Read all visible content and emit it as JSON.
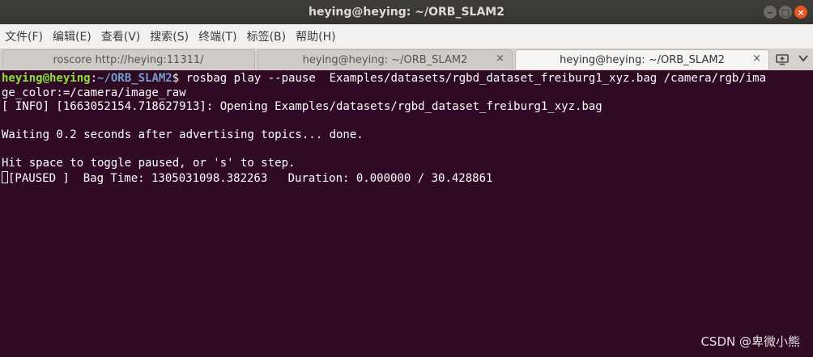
{
  "window": {
    "title": "heying@heying: ~/ORB_SLAM2",
    "controls": {
      "minimize": "‒",
      "maximize": "□",
      "close": "×"
    }
  },
  "menubar": {
    "items": [
      "文件(F)",
      "编辑(E)",
      "查看(V)",
      "搜索(S)",
      "终端(T)",
      "标签(B)",
      "帮助(H)"
    ]
  },
  "tabs": [
    {
      "label": "roscore http://heying:11311/",
      "active": false
    },
    {
      "label": "heying@heying: ~/ORB_SLAM2",
      "active": false,
      "close": "×"
    },
    {
      "label": "heying@heying: ~/ORB_SLAM2",
      "active": true,
      "close": "×"
    }
  ],
  "tabbar_icons": [
    "new-tab-icon",
    "tab-menu-chevron-icon"
  ],
  "terminal": {
    "prompt_user": "heying@heying",
    "prompt_sep": ":",
    "prompt_path": "~/ORB_SLAM2",
    "prompt_symbol": "$",
    "command": " rosbag play --pause  Examples/datasets/rgbd_dataset_freiburg1_xyz.bag /camera/rgb/ima",
    "command_wrap": "ge_color:=/camera/image_raw",
    "line_info": "[ INFO] [1663052154.718627913]: Opening Examples/datasets/rgbd_dataset_freiburg1_xyz.bag",
    "line_waiting": "Waiting 0.2 seconds after advertising topics... done.",
    "line_hint": "Hit space to toggle paused, or 's' to step.",
    "line_status": "[PAUSED ]  Bag Time: 1305031098.382263   Duration: 0.000000 / 30.428861"
  },
  "watermark": "CSDN @卑微小熊",
  "colors": {
    "terminal_bg": "#300a24",
    "prompt_user": "#8ae234",
    "prompt_path": "#729fcf",
    "accent_close": "#e95420"
  }
}
